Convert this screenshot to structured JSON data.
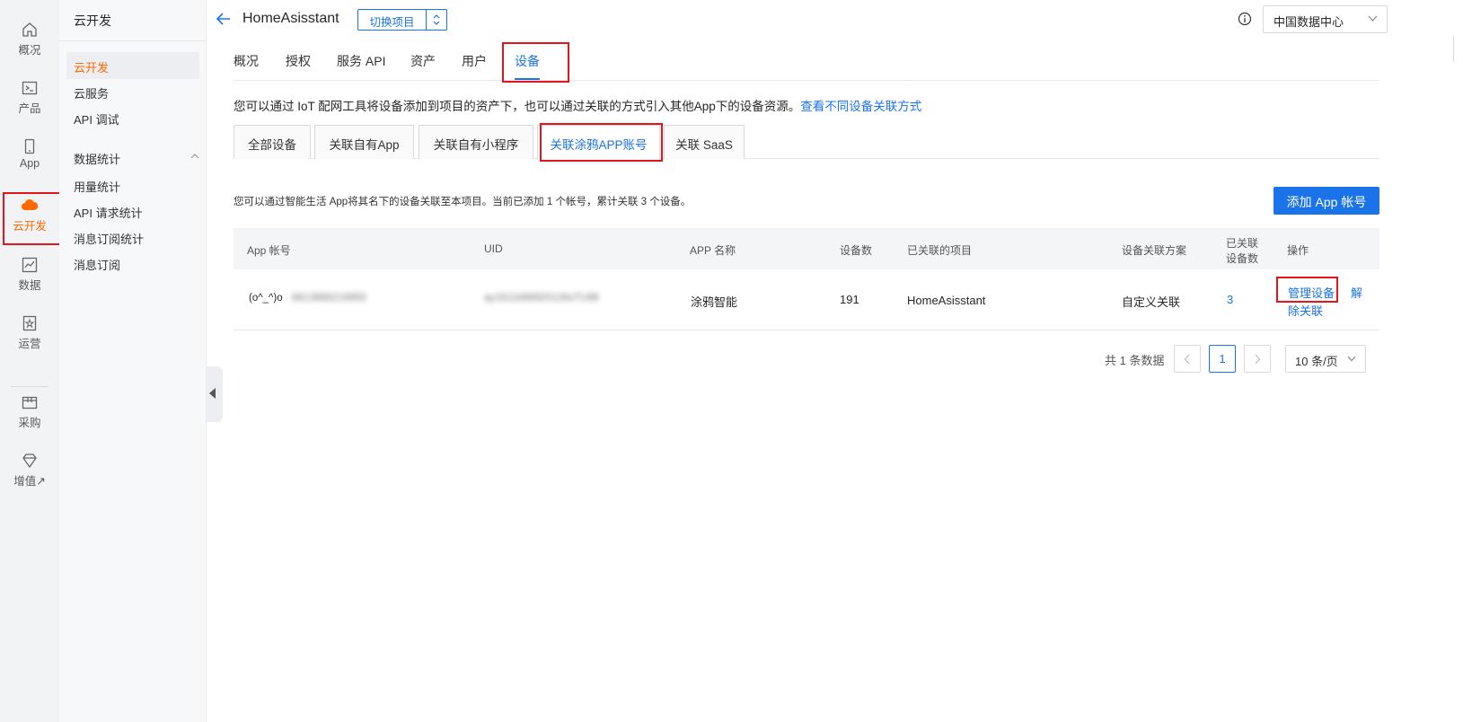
{
  "nav_rail": {
    "items": [
      {
        "label": "概况",
        "icon": "home-icon"
      },
      {
        "label": "产品",
        "icon": "terminal-icon"
      },
      {
        "label": "App",
        "icon": "phone-icon"
      },
      {
        "label": "云开发",
        "icon": "cloud-icon"
      },
      {
        "label": "数据",
        "icon": "chart-icon"
      },
      {
        "label": "运营",
        "icon": "star-doc-icon"
      },
      {
        "label": "采购",
        "icon": "box-icon"
      },
      {
        "label": "增值↗",
        "icon": "diamond-icon"
      }
    ],
    "active": "云开发"
  },
  "sidebar": {
    "title": "云开发",
    "items": [
      "云开发",
      "云服务",
      "API 调试"
    ],
    "group_label": "数据统计",
    "group_items": [
      "用量统计",
      "API 请求统计",
      "消息订阅统计",
      "消息订阅"
    ]
  },
  "header": {
    "project_name": "HomeAsisstant",
    "switch_label": "切换项目",
    "region": "中国数据中心"
  },
  "main_tabs": [
    "概况",
    "授权",
    "服务 API",
    "资产",
    "用户",
    "设备"
  ],
  "active_main_tab": "设备",
  "description": {
    "text": "您可以通过 IoT 配网工具将设备添加到项目的资产下，也可以通过关联的方式引入其他App下的设备资源。",
    "link": "查看不同设备关联方式"
  },
  "sub_tabs": [
    "全部设备",
    "关联自有App",
    "关联自有小程序",
    "关联涂鸦APP账号",
    "关联 SaaS"
  ],
  "active_sub_tab": "关联涂鸦APP账号",
  "summary": "您可以通过智能生活 App将其名下的设备关联至本项目。当前已添加 1 个帐号，累计关联 3 个设备。",
  "add_button": "添加 App 帐号",
  "table": {
    "headers": {
      "account": "App 帐号",
      "uid": "UID",
      "app_name": "APP 名称",
      "device_count": "设备数",
      "linked_project": "已关联的项目",
      "scheme": "设备关联方案",
      "linked_count_line1": "已关联",
      "linked_count_line2": "设备数",
      "ops": "操作"
    },
    "rows": [
      {
        "account_emoji": "(o^_^)o",
        "account_blurred": "8613866219955",
        "uid_blurred": "ay1611688920126xTU96",
        "app_name": "涂鸦智能",
        "device_count": "191",
        "linked_project": "HomeAsisstant",
        "scheme": "自定义关联",
        "linked_count": "3",
        "op_manage": "管理设备",
        "op_unlink_1": "解",
        "op_unlink_2": "除关联"
      }
    ]
  },
  "pagination": {
    "total": "共 1 条数据",
    "current_page": "1",
    "page_size": "10 条/页"
  },
  "colors": {
    "accent": "#1a73e8",
    "brand": "#ff6a00",
    "highlight": "#e3141b"
  }
}
